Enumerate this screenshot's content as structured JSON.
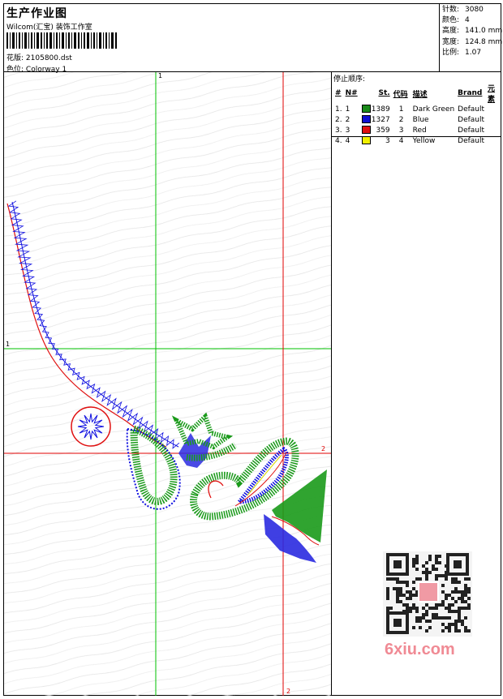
{
  "header": {
    "title": "生产作业图",
    "company": "Wilcom(汇宝) 装饰工作室",
    "design_label": "花版:",
    "design_value": "2105800.dst",
    "colorway_label": "色位:",
    "colorway_value": "Colorway 1"
  },
  "stats": [
    {
      "label": "针数:",
      "value": "3080"
    },
    {
      "label": "颜色:",
      "value": "4"
    },
    {
      "label": "高度:",
      "value": "141.0 mm"
    },
    {
      "label": "宽度:",
      "value": "124.8 mm"
    },
    {
      "label": "比例:",
      "value": "1.07"
    }
  ],
  "stop_sequence": {
    "title": "停止顺序:",
    "columns": [
      "#",
      "N#",
      "St.",
      "代码",
      "描述",
      "Brand",
      "元素"
    ],
    "rows": [
      {
        "idx": "1.",
        "n": "1",
        "color": "#1a8a1a",
        "st": "1389",
        "code": "1",
        "desc": "Dark Green",
        "brand": "Default"
      },
      {
        "idx": "2.",
        "n": "2",
        "color": "#1010d0",
        "st": "1327",
        "code": "2",
        "desc": "Blue",
        "brand": "Default"
      },
      {
        "idx": "3.",
        "n": "3",
        "color": "#e01010",
        "st": "359",
        "code": "3",
        "desc": "Red",
        "brand": "Default"
      },
      {
        "idx": "4.",
        "n": "4",
        "color": "#f0f000",
        "st": "3",
        "code": "4",
        "desc": "Yellow",
        "brand": "Default"
      }
    ]
  },
  "guides": {
    "green_v": "1",
    "green_h": "1",
    "red_h": "2",
    "red_v": "2"
  },
  "watermark": {
    "site": "6xiu.com"
  },
  "colors": {
    "green": "#1a9a1a",
    "blue": "#1010e0",
    "red": "#e01010",
    "guide_green": "#00c000",
    "guide_red": "#e00000"
  }
}
